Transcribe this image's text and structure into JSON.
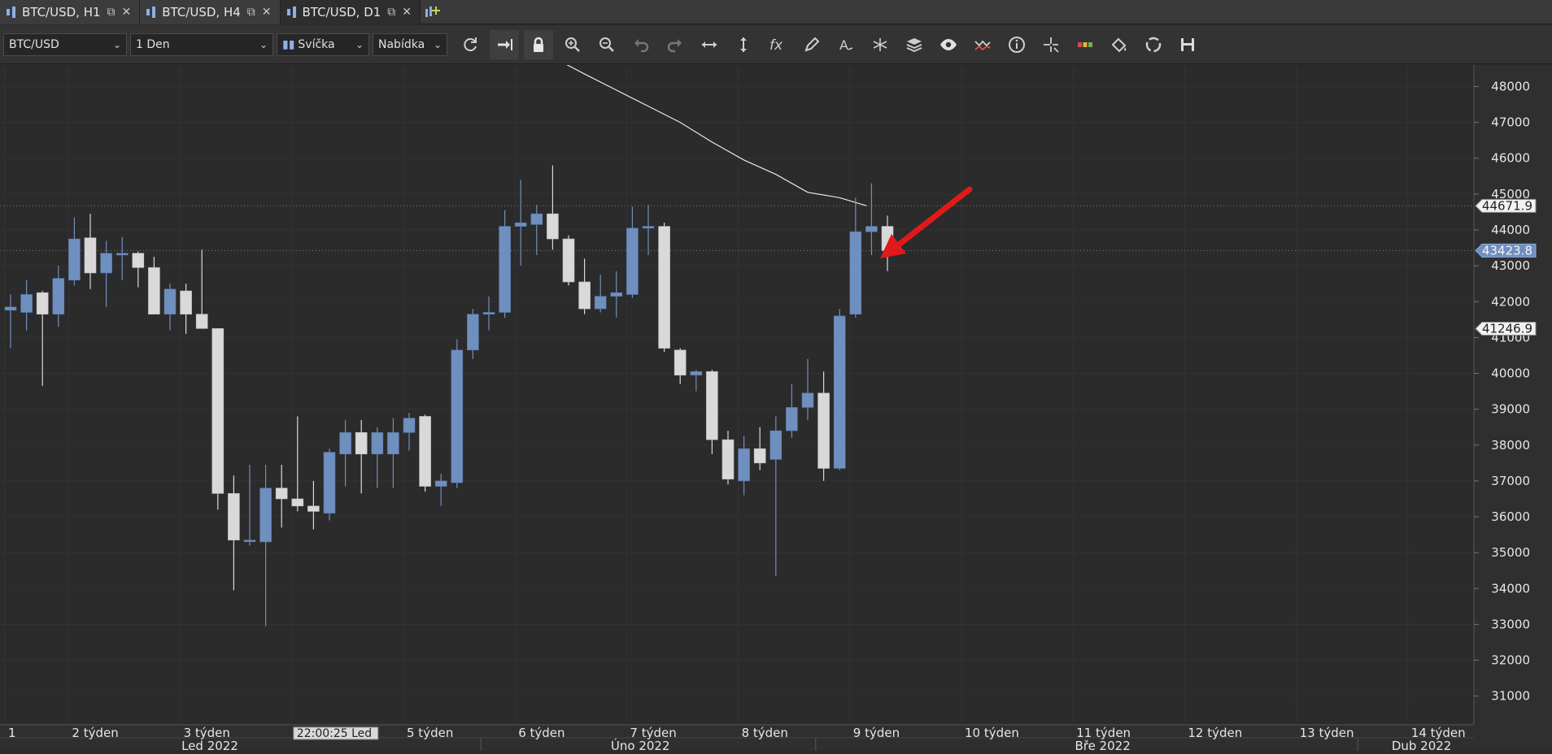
{
  "tabs": [
    {
      "label": "BTC/USD, H1",
      "active": false
    },
    {
      "label": "BTC/USD, H4",
      "active": false
    },
    {
      "label": "BTC/USD, D1",
      "active": true
    }
  ],
  "toolbar": {
    "symbol": "BTC/USD",
    "timeframe": "1 Den",
    "chart_type": "Svíčka",
    "price_side": "Nabídka",
    "icons": [
      "refresh-icon",
      "autoscroll-icon",
      "lock-icon",
      "zoom-in-icon",
      "zoom-out-icon",
      "undo-icon",
      "redo-icon",
      "horizontal-fit-icon",
      "vertical-fit-icon",
      "fx-icon",
      "pencil-icon",
      "text-tool-icon",
      "pattern-icon",
      "layers-icon",
      "eye-icon",
      "indicator-icon",
      "info-icon",
      "crosshair-icon",
      "color-icon",
      "paint-icon",
      "sync-icon",
      "save-icon"
    ]
  },
  "chart_data": {
    "type": "candlestick",
    "symbol": "BTC/USD",
    "timeframe": "D1",
    "ylim": [
      30200,
      48600
    ],
    "y_ticks": [
      31000,
      32000,
      33000,
      34000,
      35000,
      36000,
      37000,
      38000,
      39000,
      40000,
      41000,
      42000,
      43000,
      44000,
      45000,
      46000,
      47000,
      48000
    ],
    "colors": {
      "bull": "#6f8fbf",
      "bear": "#d9d9d9",
      "background": "#2b2b2b",
      "arrow": "#e01a1a",
      "current_price": "#6f8fbf"
    },
    "candles": [
      {
        "o": 41760,
        "h": 42200,
        "l": 40700,
        "c": 41850
      },
      {
        "o": 41700,
        "h": 42600,
        "l": 41200,
        "c": 42200
      },
      {
        "o": 42250,
        "h": 42300,
        "l": 39650,
        "c": 41650
      },
      {
        "o": 41650,
        "h": 43000,
        "l": 41300,
        "c": 42650
      },
      {
        "o": 42600,
        "h": 44350,
        "l": 42450,
        "c": 43750
      },
      {
        "o": 43780,
        "h": 44450,
        "l": 42350,
        "c": 42800
      },
      {
        "o": 42800,
        "h": 43700,
        "l": 41850,
        "c": 43350
      },
      {
        "o": 43300,
        "h": 43800,
        "l": 42600,
        "c": 43350
      },
      {
        "o": 43350,
        "h": 43400,
        "l": 42400,
        "c": 42950
      },
      {
        "o": 42950,
        "h": 43250,
        "l": 41700,
        "c": 41650
      },
      {
        "o": 41650,
        "h": 42500,
        "l": 41200,
        "c": 42350
      },
      {
        "o": 42300,
        "h": 42500,
        "l": 41100,
        "c": 41650
      },
      {
        "o": 41650,
        "h": 43450,
        "l": 41250,
        "c": 41250
      },
      {
        "o": 41250,
        "h": 41250,
        "l": 36200,
        "c": 36650
      },
      {
        "o": 36650,
        "h": 37150,
        "l": 33950,
        "c": 35350
      },
      {
        "o": 35350,
        "h": 37450,
        "l": 35200,
        "c": 35350
      },
      {
        "o": 35300,
        "h": 37450,
        "l": 32950,
        "c": 36800
      },
      {
        "o": 36800,
        "h": 37450,
        "l": 35700,
        "c": 36500
      },
      {
        "o": 36500,
        "h": 38800,
        "l": 36150,
        "c": 36300
      },
      {
        "o": 36300,
        "h": 37000,
        "l": 35650,
        "c": 36150
      },
      {
        "o": 36100,
        "h": 37900,
        "l": 35900,
        "c": 37800
      },
      {
        "o": 37750,
        "h": 38700,
        "l": 36850,
        "c": 38350
      },
      {
        "o": 38350,
        "h": 38700,
        "l": 36650,
        "c": 37750
      },
      {
        "o": 37750,
        "h": 38500,
        "l": 36800,
        "c": 38350
      },
      {
        "o": 37750,
        "h": 38750,
        "l": 36800,
        "c": 38350
      },
      {
        "o": 38350,
        "h": 38900,
        "l": 37850,
        "c": 38750
      },
      {
        "o": 38800,
        "h": 38850,
        "l": 36700,
        "c": 36850
      },
      {
        "o": 36850,
        "h": 37200,
        "l": 36300,
        "c": 37000
      },
      {
        "o": 36950,
        "h": 40950,
        "l": 36800,
        "c": 40650
      },
      {
        "o": 40650,
        "h": 41800,
        "l": 40400,
        "c": 41650
      },
      {
        "o": 41650,
        "h": 42150,
        "l": 41200,
        "c": 41700
      },
      {
        "o": 41700,
        "h": 44550,
        "l": 41550,
        "c": 44100
      },
      {
        "o": 44100,
        "h": 45400,
        "l": 43000,
        "c": 44200
      },
      {
        "o": 44150,
        "h": 44700,
        "l": 43300,
        "c": 44450
      },
      {
        "o": 44450,
        "h": 45800,
        "l": 43450,
        "c": 43750
      },
      {
        "o": 43750,
        "h": 43850,
        "l": 42450,
        "c": 42550
      },
      {
        "o": 42550,
        "h": 43200,
        "l": 41650,
        "c": 41800
      },
      {
        "o": 41800,
        "h": 42750,
        "l": 41700,
        "c": 42150
      },
      {
        "o": 42150,
        "h": 42850,
        "l": 41550,
        "c": 42250
      },
      {
        "o": 42200,
        "h": 44650,
        "l": 42100,
        "c": 44050
      },
      {
        "o": 44050,
        "h": 44700,
        "l": 43300,
        "c": 44100
      },
      {
        "o": 44100,
        "h": 44200,
        "l": 40600,
        "c": 40700
      },
      {
        "o": 40650,
        "h": 40700,
        "l": 39700,
        "c": 39950
      },
      {
        "o": 39950,
        "h": 40100,
        "l": 39500,
        "c": 40050
      },
      {
        "o": 40050,
        "h": 40100,
        "l": 37750,
        "c": 38150
      },
      {
        "o": 38150,
        "h": 38400,
        "l": 36900,
        "c": 37050
      },
      {
        "o": 37000,
        "h": 38250,
        "l": 36600,
        "c": 37900
      },
      {
        "o": 37900,
        "h": 38500,
        "l": 37300,
        "c": 37500
      },
      {
        "o": 37600,
        "h": 38800,
        "l": 34350,
        "c": 38400
      },
      {
        "o": 38400,
        "h": 39700,
        "l": 38200,
        "c": 39050
      },
      {
        "o": 39050,
        "h": 40400,
        "l": 38700,
        "c": 39450
      },
      {
        "o": 39450,
        "h": 40050,
        "l": 37000,
        "c": 37350
      },
      {
        "o": 37350,
        "h": 41800,
        "l": 37300,
        "c": 41600
      },
      {
        "o": 41650,
        "h": 44900,
        "l": 41550,
        "c": 43950
      },
      {
        "o": 43950,
        "h": 45300,
        "l": 43300,
        "c": 44100
      },
      {
        "o": 44100,
        "h": 44400,
        "l": 42850,
        "c": 43423.8
      }
    ],
    "moving_average_tail": [
      {
        "i": 34.5,
        "v": 48700
      },
      {
        "i": 36,
        "v": 48350
      },
      {
        "i": 38,
        "v": 47900
      },
      {
        "i": 40,
        "v": 47450
      },
      {
        "i": 42,
        "v": 47000
      },
      {
        "i": 44,
        "v": 46450
      },
      {
        "i": 46,
        "v": 45950
      },
      {
        "i": 48,
        "v": 45550
      },
      {
        "i": 50,
        "v": 45050
      },
      {
        "i": 52,
        "v": 44900
      },
      {
        "i": 53.7,
        "v": 44671.9
      }
    ],
    "price_labels": [
      {
        "value": 44671.9,
        "label": "44671.9",
        "style": "outline",
        "dotted_line": true
      },
      {
        "value": 43423.8,
        "label": "43423.8",
        "style": "filled",
        "dotted_line": true
      },
      {
        "value": 41246.9,
        "label": "41246.9",
        "style": "outline",
        "dotted_line": false
      }
    ],
    "x_labels": [
      {
        "label": "1",
        "i": 0
      },
      {
        "label": "2 týden",
        "i": 4
      },
      {
        "label": "3 týden",
        "i": 11
      },
      {
        "label": "22:00:25 Led",
        "i": 18,
        "boxed": true
      },
      {
        "label": "5 týden",
        "i": 25
      },
      {
        "label": "6 týden",
        "i": 32
      },
      {
        "label": "7 týden",
        "i": 39
      },
      {
        "label": "8 týden",
        "i": 46
      },
      {
        "label": "9 týden",
        "i": 53
      },
      {
        "label": "10 týden",
        "i": 60
      },
      {
        "label": "11 týden",
        "i": 67
      },
      {
        "label": "12 týden",
        "i": 74
      },
      {
        "label": "13 týden",
        "i": 81
      },
      {
        "label": "14 týden",
        "i": 88
      }
    ],
    "month_labels": [
      {
        "label": "Led 2022",
        "i": 12.5
      },
      {
        "label": "Úno 2022",
        "i": 39.5
      },
      {
        "label": "Bře 2022",
        "i": 68.5
      },
      {
        "label": "Dub 2022",
        "i": 88.5
      }
    ],
    "grid": true
  }
}
